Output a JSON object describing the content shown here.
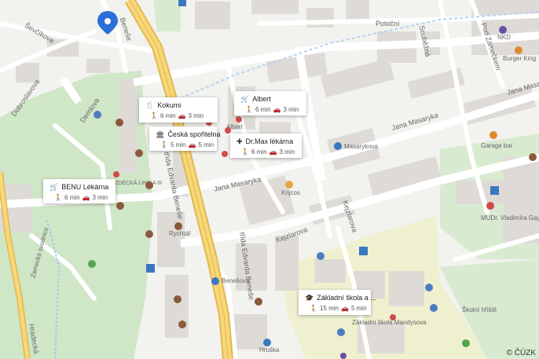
{
  "copyright": "© ČÚZK",
  "streets": {
    "jana_masaryka_1": "Jana Masaryka",
    "jana_masaryka_2": "Jana Masaryka",
    "jana_masaryka_3": "Jana Masaryka",
    "trida_edvarda_benese_1": "třída Edvarda Beneše",
    "trida_edvarda_benese_2": "třída Edvarda Beneše",
    "kejzlarova": "Kejzlarova",
    "kejzlarova_2": "Kejzlarova",
    "sevcikova": "Ševčíkova",
    "dobroslavova": "Dobroslavova",
    "demlova": "Demlova",
    "potocni": "Potoční",
    "soubezna": "Souběžná",
    "pod_zamecekem": "Pod Zámečkem",
    "hradecka": "Hradecká",
    "zamecka_svodnice": "Zámecká svodnice",
    "benese_top": "Beneše"
  },
  "places": {
    "albert": "Albert",
    "masarykova": "Masarykova",
    "krijcos": "Krijcos",
    "rychtar": "Rychtář",
    "benesova": "Benešova",
    "hruska": "Hruška",
    "nkd": "NKD",
    "burger_king": "Burger King",
    "garage_bar": "Garage bar",
    "mudr": "MUDr. Vladimíra Gayerová",
    "zakladni_skola_mandysova": "Základní škola Mandysova",
    "skolni_hriste": "Školní hřiště",
    "klinika": "ZDECKÁ LINIKA III"
  },
  "cards": [
    {
      "name": "Kokumi",
      "walk": "6 min",
      "car": "3 min",
      "icon": "restaurant-icon"
    },
    {
      "name": "Albert",
      "walk": "6 min",
      "car": "3 min",
      "icon": "shopping-cart-icon"
    },
    {
      "name": "Česká spořitelna",
      "walk": "5 min",
      "car": "5 min",
      "icon": "bank-icon"
    },
    {
      "name": "Dr.Max lékárna",
      "walk": "6 min",
      "car": "3 min",
      "icon": "pharmacy-icon"
    },
    {
      "name": "BENU Lékárna",
      "walk": "6 min",
      "car": "3 min",
      "icon": "shopping-cart-icon"
    },
    {
      "name": "Základní škola a ...",
      "walk": "15 min",
      "car": "5 min",
      "icon": "school-icon"
    }
  ],
  "colors": {
    "background": "#f2f2ef",
    "park": "#cfe6c7",
    "school_area": "#eef0cf",
    "main_road": "#f7d77a",
    "main_road_edge": "#e2b84e",
    "road": "#ffffff",
    "building": "#dedbd7",
    "pin": "#2a6fd6"
  }
}
